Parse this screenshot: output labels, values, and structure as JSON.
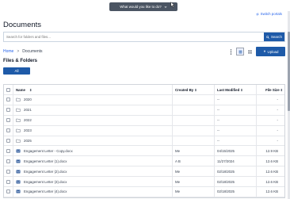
{
  "topbar": {
    "prompt_label": "What would you like to do?",
    "switch_portals": "Switch portals"
  },
  "page": {
    "title": "Documents"
  },
  "search": {
    "placeholder": "Search for folders and files...",
    "button_label": "Search"
  },
  "breadcrumb": {
    "home": "Home",
    "separator": ">",
    "current": "Documents"
  },
  "toolbar": {
    "upload_label": "Upload"
  },
  "section": {
    "title": "Files & Folders",
    "tab_all": "All"
  },
  "table": {
    "headers": {
      "name": "Name",
      "created_by": "Created By",
      "last_modified": "Last Modified",
      "file_size": "File Size"
    },
    "sort_glyph": "⇕",
    "rows": [
      {
        "type": "folder",
        "name": "2020",
        "created_by": "",
        "last_modified": "--",
        "file_size": "-"
      },
      {
        "type": "folder",
        "name": "2021",
        "created_by": "",
        "last_modified": "--",
        "file_size": "-"
      },
      {
        "type": "folder",
        "name": "2022",
        "created_by": "",
        "last_modified": "--",
        "file_size": "-"
      },
      {
        "type": "folder",
        "name": "2023",
        "created_by": "",
        "last_modified": "--",
        "file_size": "-"
      },
      {
        "type": "folder",
        "name": "2025",
        "created_by": "",
        "last_modified": "--",
        "file_size": "-"
      },
      {
        "type": "file",
        "name": "Engagement Letter - Copy.docx",
        "created_by": "Me",
        "last_modified": "04/15/2025",
        "file_size": "12.9 KB"
      },
      {
        "type": "file",
        "name": "Engagement Letter (1).docx",
        "created_by": "A B",
        "last_modified": "11/27/2024",
        "file_size": "12.6 KB"
      },
      {
        "type": "file",
        "name": "Engagement Letter (2).docx",
        "created_by": "Me",
        "last_modified": "02/18/2025",
        "file_size": "12.6 KB"
      },
      {
        "type": "file",
        "name": "Engagement Letter (3).docx",
        "created_by": "Me",
        "last_modified": "02/18/2025",
        "file_size": "12.6 KB"
      },
      {
        "type": "file",
        "name": "Engagement Letter (4).docx",
        "created_by": "Me",
        "last_modified": "02/18/2025",
        "file_size": "12.6 KB"
      }
    ]
  },
  "colors": {
    "primary": "#1e5aa8",
    "link": "#2563eb",
    "folder_icon": "#6b7280",
    "file_icon": "#2b579a"
  },
  "icons": {
    "folder": "folder-icon",
    "file": "word-doc-icon",
    "search": "search-icon",
    "upload": "upload-icon"
  }
}
